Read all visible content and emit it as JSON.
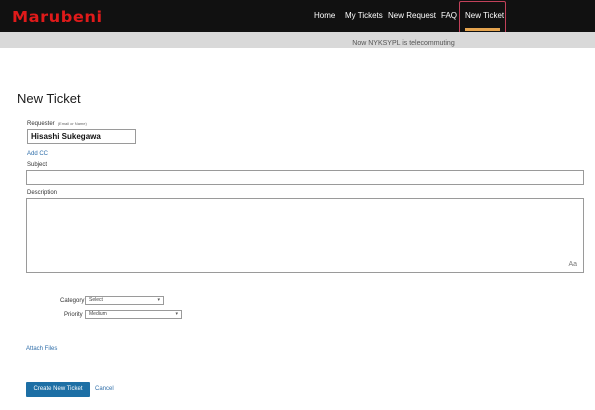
{
  "header": {
    "logo": "Marubeni",
    "nav": [
      "Home",
      "My Tickets",
      "New Request",
      "FAQ",
      "New Ticket"
    ],
    "active": "New Ticket"
  },
  "banner": {
    "text": "Now NYKSYPL is telecommuting"
  },
  "form": {
    "title": "New Ticket",
    "requester_label": "Requester",
    "requester_hint": "(Email or Name)",
    "requester_value": "Hisashi Sukegawa",
    "add_cc": "Add CC",
    "subject_label": "Subject",
    "subject_value": "",
    "description_label": "Description",
    "description_value": "",
    "description_icon": "Aa",
    "category_label": "Category",
    "category_value": "Select",
    "priority_label": "Priority",
    "priority_value": "Medium",
    "attach_files": "Attach Files",
    "submit": "Create New Ticket",
    "cancel": "Cancel"
  },
  "colors": {
    "topbar": "#111111",
    "logo": "#e01a1a",
    "banner": "#d9d9d9",
    "primary_button": "#1d6fa5",
    "link": "#2f6ea9",
    "active_highlight": "#c2415a",
    "active_underline": "#e4a44f"
  }
}
